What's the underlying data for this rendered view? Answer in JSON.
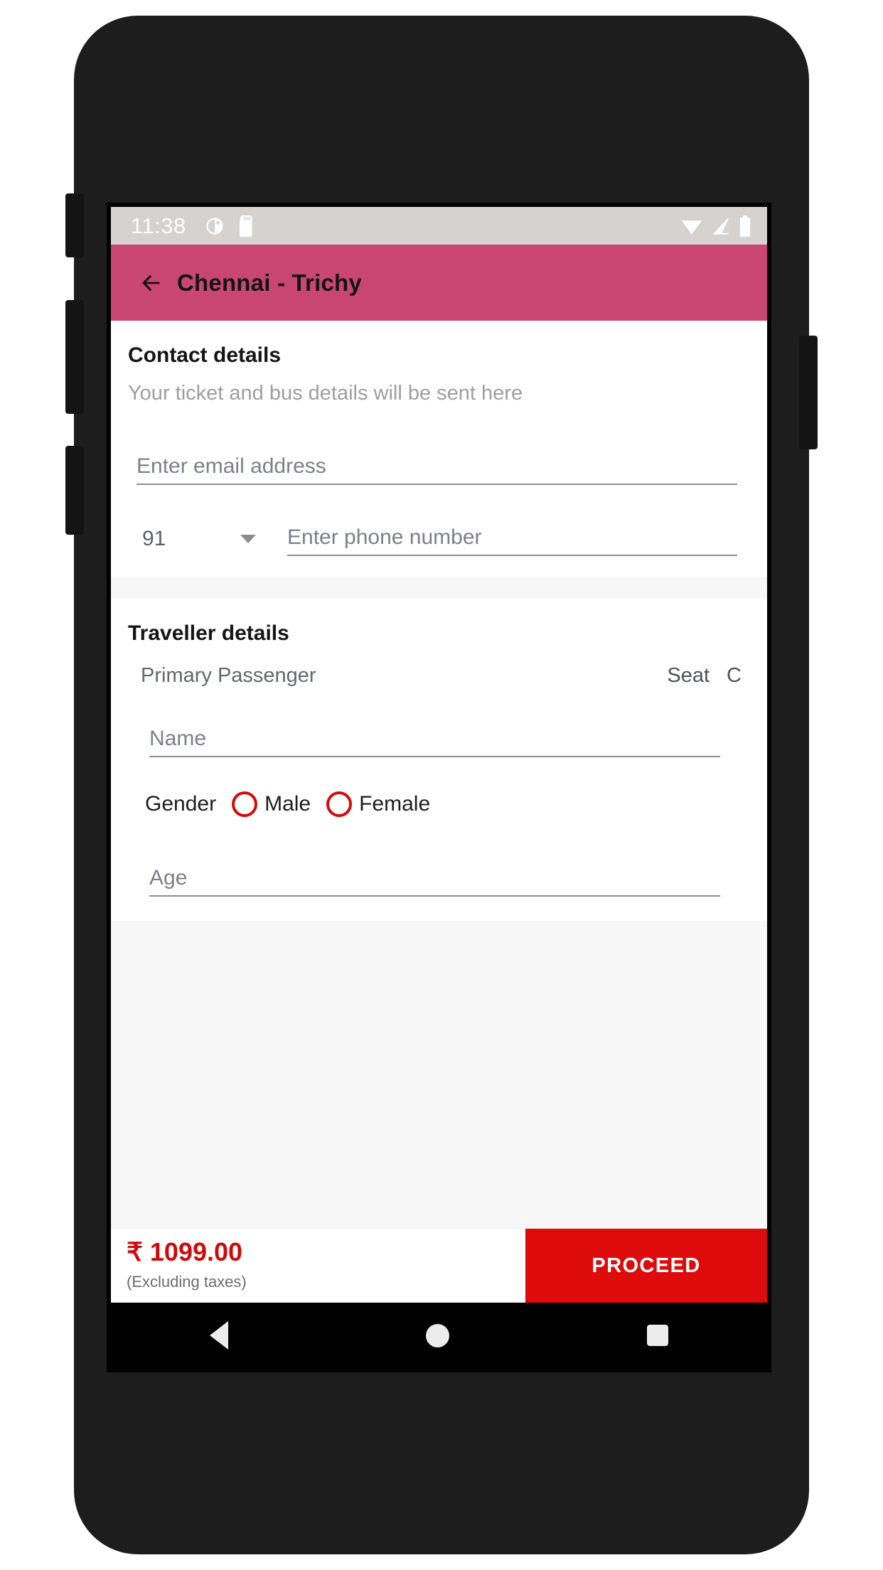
{
  "status_bar": {
    "clock": "11:38",
    "left_icons": [
      "alarm-icon",
      "sd-card-icon"
    ],
    "right_icons": [
      "wifi-icon",
      "cellular-signal-icon",
      "battery-icon"
    ]
  },
  "app_bar": {
    "back_icon": "back-arrow-icon",
    "title": "Chennai - Trichy",
    "background_color": "#c94672"
  },
  "contact": {
    "title": "Contact details",
    "subtitle": "Your ticket and bus details will be sent here",
    "email": {
      "value": "",
      "placeholder": "Enter email address"
    },
    "country_code": {
      "value": "91",
      "caret_icon": "chevron-down-icon"
    },
    "phone": {
      "value": "",
      "placeholder": "Enter phone number"
    }
  },
  "traveller": {
    "title": "Traveller details",
    "passenger_label": "Primary Passenger",
    "seat_label": "Seat",
    "seat_value": "C",
    "name": {
      "value": "",
      "placeholder": "Name"
    },
    "gender": {
      "label": "Gender",
      "options": [
        {
          "label": "Male",
          "selected": false
        },
        {
          "label": "Female",
          "selected": false
        }
      ],
      "radio_color": "#d60a0a"
    },
    "age": {
      "value": "",
      "placeholder": "Age"
    }
  },
  "bottom_bar": {
    "price": "₹ 1099.00",
    "price_note": "(Excluding taxes)",
    "proceed_label": "PROCEED",
    "proceed_color": "#dd0b0b",
    "price_color": "#cc0b0b"
  },
  "nav_bar": {
    "back_icon": "nav-back-triangle-icon",
    "home_icon": "nav-home-circle-icon",
    "recents_icon": "nav-recents-square-icon"
  }
}
